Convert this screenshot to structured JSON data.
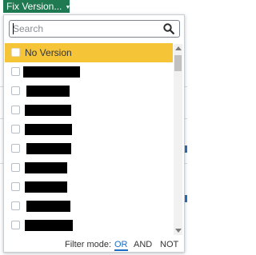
{
  "toolbar": {
    "fix_version_label": "Fix Version..."
  },
  "dropdown": {
    "search_placeholder": "Search",
    "items": [
      {
        "label": "No Version",
        "selected": true
      },
      {
        "label": "",
        "redacted": true
      },
      {
        "label": "",
        "redacted": true
      },
      {
        "label": "",
        "redacted": true
      },
      {
        "label": "",
        "redacted": true
      },
      {
        "label": "",
        "redacted": true
      },
      {
        "label": "",
        "redacted": true
      },
      {
        "label": "",
        "redacted": true
      },
      {
        "label": "",
        "redacted": true
      },
      {
        "label": "",
        "redacted": true
      }
    ],
    "filter_mode_label": "Filter mode:",
    "modes": [
      "OR",
      "AND",
      "NOT"
    ],
    "active_mode": "OR"
  },
  "colors": {
    "button_bg": "#1f7a52",
    "selected_item_bg": "#f6c437",
    "active_mode": "#1b6cc4"
  }
}
